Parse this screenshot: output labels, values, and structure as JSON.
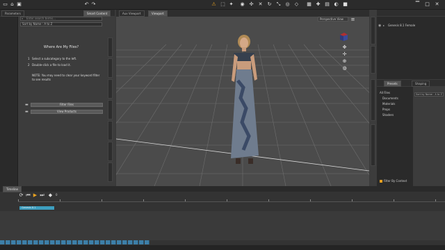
{
  "left_panel": {
    "header_tab": "Smart Content",
    "header_tab2": "Parameters",
    "search_placeholder": "Enter search terms...",
    "sort_label": "Sort by Name : A to Z",
    "title": "Where Are My Files?",
    "step1": "Select a subcategory to the left.",
    "step2": "Double-click a file to load it.",
    "note": "NOTE: You may need to clear your keyword filter to see results",
    "button_filter": "Filter Files",
    "button_products": "View Products"
  },
  "viewport": {
    "tab_aux": "Aux Viewport",
    "tab_main": "Viewport",
    "camera_label": "Perspective View"
  },
  "right_panel": {
    "scene_item": "Genesis 8.1 Female",
    "presets_tab": "Presets",
    "tab2": "Shaping",
    "sort_label": "Sort by Name : A to Z",
    "categories": [
      "All Files",
      "Documents",
      "Materials",
      "Props",
      "Shaders"
    ],
    "filter_checkbox": "Filter By Context"
  },
  "timeline": {
    "tab": "Timeline",
    "frame_value": "0",
    "track_label": "Genesis 8.1"
  },
  "colors": {
    "accent_blue": "#3d7fa8",
    "active_orange": "#e6a020",
    "panel_bg": "#3a3a3a",
    "viewport_bg": "#4a4a4a"
  }
}
